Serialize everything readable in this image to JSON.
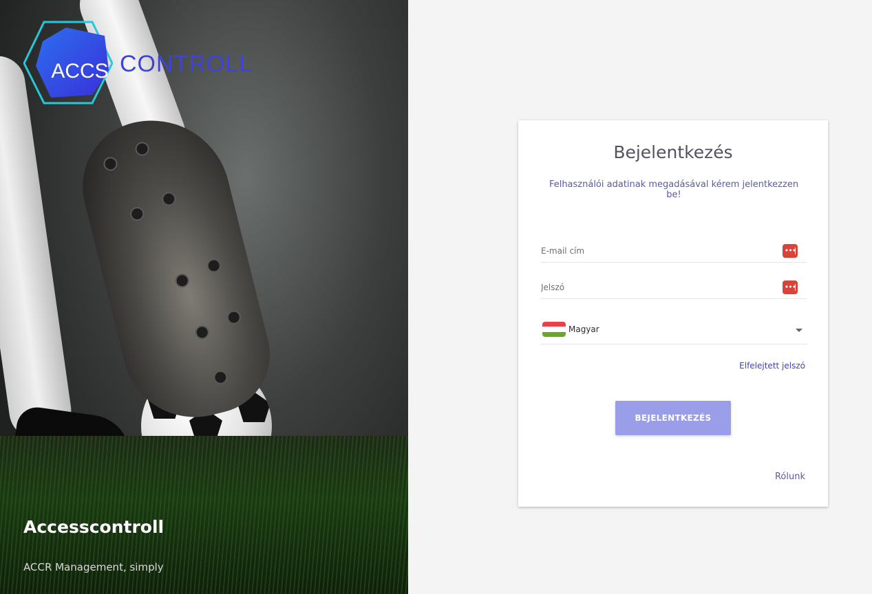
{
  "brand": {
    "logo_mark_text": "ACCS",
    "logo_word_text": "CONTROLL",
    "hero_title": "Accesscontroll",
    "hero_subtitle": "ACCR Management, simply"
  },
  "login": {
    "title": "Bejelentkezés",
    "subtitle": "Felhasználói adatinak megadásával kérem jelentkezzen be!",
    "email_placeholder": "E-mail cím",
    "password_placeholder": "Jelszó",
    "password_manager_icon": "password-manager-icon",
    "language": {
      "selected": "Magyar",
      "flag_colors": [
        "#e5424c",
        "#ffffff",
        "#6aa628"
      ]
    },
    "forgot_password_label": "Elfelejtett jelszó",
    "submit_label": "BEJELENTKEZÉS",
    "about_label": "Rólunk"
  },
  "colors": {
    "accent": "#3f43d6",
    "button": "#9a9ee9",
    "icon_red": "#d9443a"
  }
}
